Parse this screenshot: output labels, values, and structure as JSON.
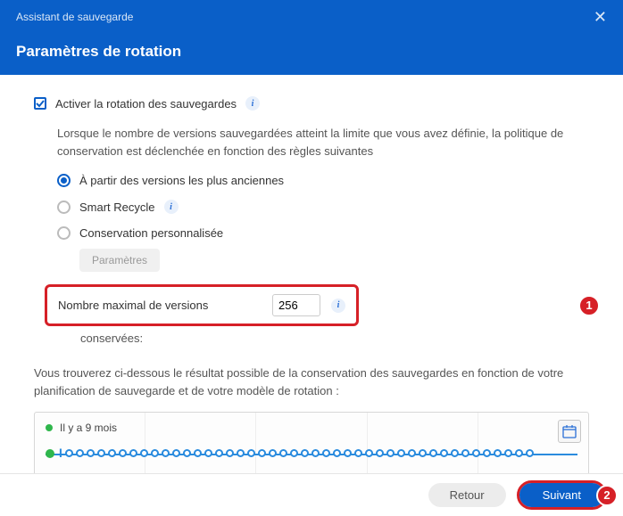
{
  "header": {
    "assistant_label": "Assistant de sauvegarde",
    "title": "Paramètres de rotation"
  },
  "enable": {
    "label": "Activer la rotation des sauvegardes"
  },
  "description": "Lorsque le nombre de versions sauvegardées atteint la limite que vous avez définie, la politique de conservation est déclenchée en fonction des règles suivantes",
  "radios": {
    "oldest": "À partir des versions les plus anciennes",
    "smart": "Smart Recycle",
    "custom": "Conservation personnalisée"
  },
  "settings_button": "Paramètres",
  "max_versions": {
    "label": "Nombre maximal de versions",
    "value": "256"
  },
  "conserved_label": "conservées:",
  "below_desc": "Vous trouverez ci-dessous le résultat possible de la conservation des sauvegardes en fonction de votre planification de sauvegarde et de votre modèle de rotation :",
  "timeline": {
    "label": "Il y a 9 mois"
  },
  "footer": {
    "back": "Retour",
    "next": "Suivant"
  },
  "markers": {
    "one": "1",
    "two": "2"
  }
}
